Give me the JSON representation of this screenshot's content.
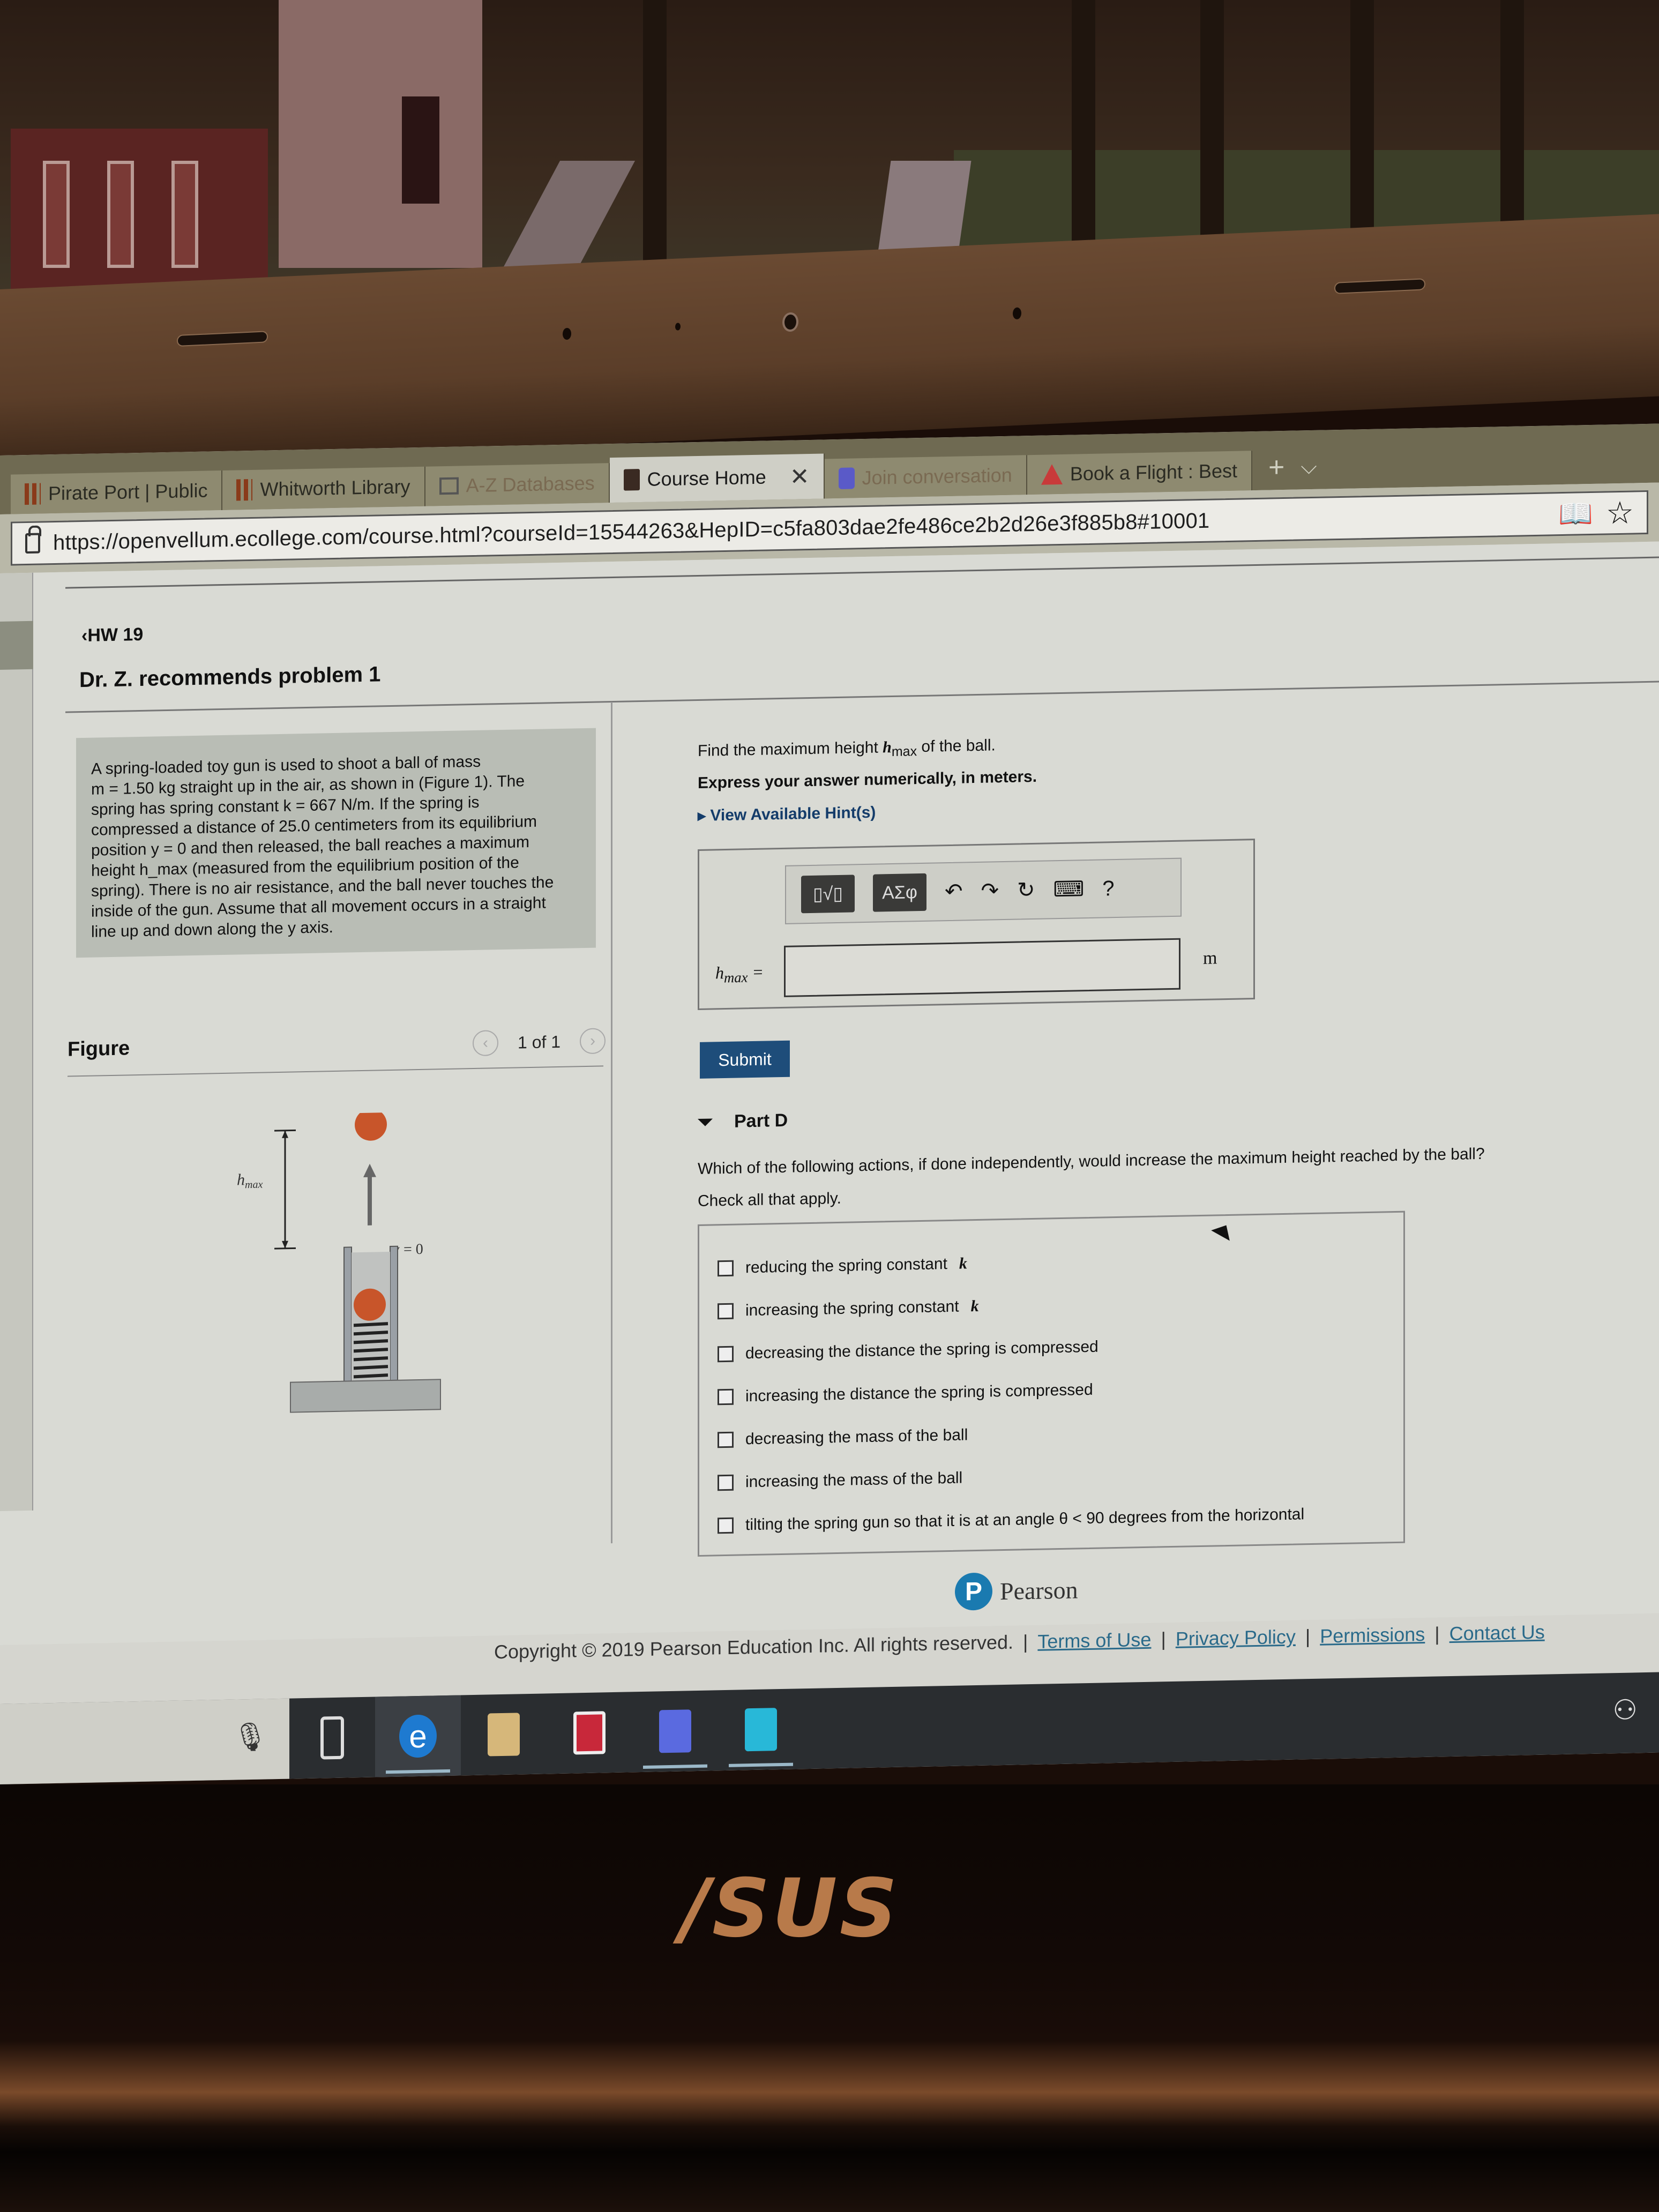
{
  "browser": {
    "tabs": [
      {
        "label": "Pirate Port | Public",
        "icon": "library-icon",
        "active": false
      },
      {
        "label": "Whitworth Library",
        "icon": "library-icon",
        "active": false
      },
      {
        "label": "A-Z Databases",
        "icon": "database-icon",
        "active": false
      },
      {
        "label": "Course Home",
        "icon": "book-icon",
        "active": true,
        "close": "✕"
      },
      {
        "label": "Join conversation",
        "icon": "teams-icon",
        "active": false
      },
      {
        "label": "Book a Flight : Best",
        "icon": "flight-icon",
        "active": false
      }
    ],
    "new_tab": "+",
    "tab_menu": "⌵",
    "url": "https://openvellum.ecollege.com/course.html?courseId=15544263&HepID=c5fa803dae2fe486ce2b2d26e3f885b8#10001",
    "reading_view_icon": "📖",
    "favorite_icon": "☆"
  },
  "page": {
    "back_link": "HW 19",
    "title": "Dr. Z. recommends problem 1",
    "problem_text": [
      "A spring-loaded toy gun is used to shoot a ball of mass",
      "m = 1.50 kg straight up in the air, as shown in (Figure 1). The",
      "spring has spring constant k = 667 N/m. If the spring is",
      "compressed a distance of 25.0 centimeters from its equilibrium",
      "position y = 0 and then released, the ball reaches a maximum",
      "height h_max (measured from the equilibrium position of the",
      "spring). There is no air resistance, and the ball never touches the",
      "inside of the gun. Assume that all movement occurs in a straight",
      "line up and down along the y axis."
    ],
    "figure": {
      "heading": "Figure",
      "pager": "1 of 1",
      "prev": "‹",
      "next": "›",
      "label_hmax": "h",
      "label_hmax_sub": "max",
      "label_y0": "y = 0"
    },
    "question": {
      "prompt_pre": "Find the maximum height ",
      "prompt_var": "h",
      "prompt_sub": "max",
      "prompt_post": " of the ball.",
      "instruction": "Express your answer numerically, in meters.",
      "hints_link": "View Available Hint(s)",
      "toolbar": {
        "template_btn": "▯√▯",
        "greek_btn": "ΑΣφ",
        "undo": "↶",
        "redo": "↷",
        "reset": "↻",
        "keyboard": "⌨",
        "help": "?"
      },
      "answer_label": "h",
      "answer_label_sub": "max",
      "answer_eq": " =",
      "answer_value": "",
      "answer_unit": "m",
      "submit_label": "Submit"
    },
    "part_d": {
      "label": "Part D",
      "question": "Which of the following actions, if done independently, would increase the maximum height reached by the ball?",
      "instruction": "Check all that apply.",
      "options": [
        {
          "text": "reducing the spring constant ",
          "var": "k",
          "checked": false
        },
        {
          "text": "increasing the spring constant ",
          "var": "k",
          "checked": false
        },
        {
          "text": "decreasing the distance the spring is compressed",
          "var": "",
          "checked": false
        },
        {
          "text": "increasing the distance the spring is compressed",
          "var": "",
          "checked": false
        },
        {
          "text": "decreasing the mass of the ball",
          "var": "",
          "checked": false
        },
        {
          "text": "increasing the mass of the ball",
          "var": "",
          "checked": false
        },
        {
          "text": "tilting the spring gun so that it is at an angle θ < 90 degrees from the horizontal",
          "var": "",
          "checked": false
        }
      ]
    },
    "footer": {
      "brand": "Pearson",
      "brand_mark": "P",
      "copyright": "Copyright © 2019 Pearson Education Inc. All rights reserved.",
      "links": [
        "Terms of Use",
        "Privacy Policy",
        "Permissions",
        "Contact Us"
      ],
      "separator": "|"
    }
  },
  "taskbar": {
    "mic_icon": "🎙",
    "items": [
      "task-view",
      "edge",
      "file-explorer",
      "gift-app",
      "teams",
      "store"
    ],
    "edge_glyph": "e",
    "tray_icon": "people-icon",
    "tray_glyph": "⚇"
  },
  "device": {
    "brand": "/SUS"
  },
  "colors": {
    "submit_bg": "#1e4d7a",
    "hint_link": "#143c6a",
    "pearson_blue": "#1a7ab0",
    "ball": "#c8552a",
    "asus_logo": "#b87a4a"
  }
}
